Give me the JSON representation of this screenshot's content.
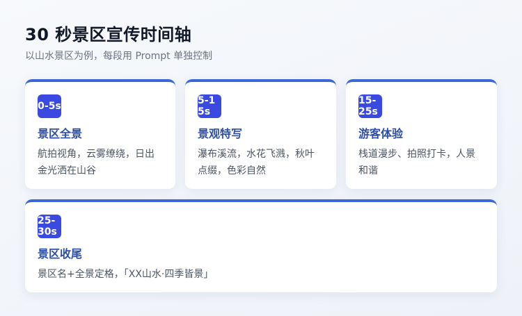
{
  "header": {
    "title": "30 秒景区宣传时间轴",
    "subtitle": "以山水景区为例，每段用 Prompt 单独控制"
  },
  "segments": [
    {
      "time": "0-5s",
      "title": "景区全景",
      "description": "航拍视角，云雾缭绕，日出金光洒在山谷"
    },
    {
      "time": "5-15s",
      "title": "景观特写",
      "description": "瀑布溪流，水花飞溅，秋叶点缀，色彩自然"
    },
    {
      "time": "15-25s",
      "title": "游客体验",
      "description": "栈道漫步、拍照打卡，人景和谐"
    },
    {
      "time": "25-30s",
      "title": "景区收尾",
      "description": "景区名+全景定格，「XX山水·四季皆景」"
    }
  ],
  "colors": {
    "accent": "#3a67d6",
    "badge": "#3a4ae0",
    "card_title": "#2d4ea6"
  }
}
